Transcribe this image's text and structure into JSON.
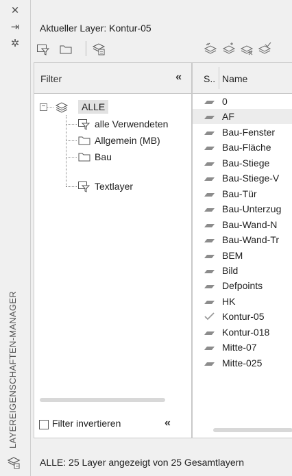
{
  "rail": {
    "close_glyph": "✕",
    "pin_glyph": "⇥",
    "settings_glyph": "✲",
    "vertical_title": "LAYEREIGENSCHAFTEN-MANAGER"
  },
  "header": {
    "current_layer_label": "Aktueller Layer: Kontur-05"
  },
  "filter_panel": {
    "heading": "Filter",
    "collapse_glyph": "«",
    "tree": {
      "root": "ALLE",
      "children": [
        "alle Verwendeten",
        "Allgemein (MB)",
        "Bau",
        "Textlayer"
      ]
    },
    "invert_label": "Filter invertieren",
    "invert_checked": false
  },
  "layer_list": {
    "col_status": "S..",
    "col_name": "Name",
    "selected_name": "AF",
    "current_name": "Kontur-05",
    "layers": [
      "0",
      "AF",
      "Bau-Fenster",
      "Bau-Fläche",
      "Bau-Stiege",
      "Bau-Stiege-V",
      "Bau-Tür",
      "Bau-Unterzug",
      "Bau-Wand-N",
      "Bau-Wand-Tr",
      "BEM",
      "Bild",
      "Defpoints",
      "HK",
      "Kontur-05",
      "Kontur-018",
      "Mitte-07",
      "Mitte-025"
    ]
  },
  "status_bar": {
    "text": "ALLE: 25 Layer angezeigt von 25 Gesamtlayern"
  },
  "colors": {
    "panel_bg": "#f0f0f0",
    "list_bg": "#ffffff",
    "selected_row": "#ececec",
    "current_check": "#9a9a9a"
  }
}
